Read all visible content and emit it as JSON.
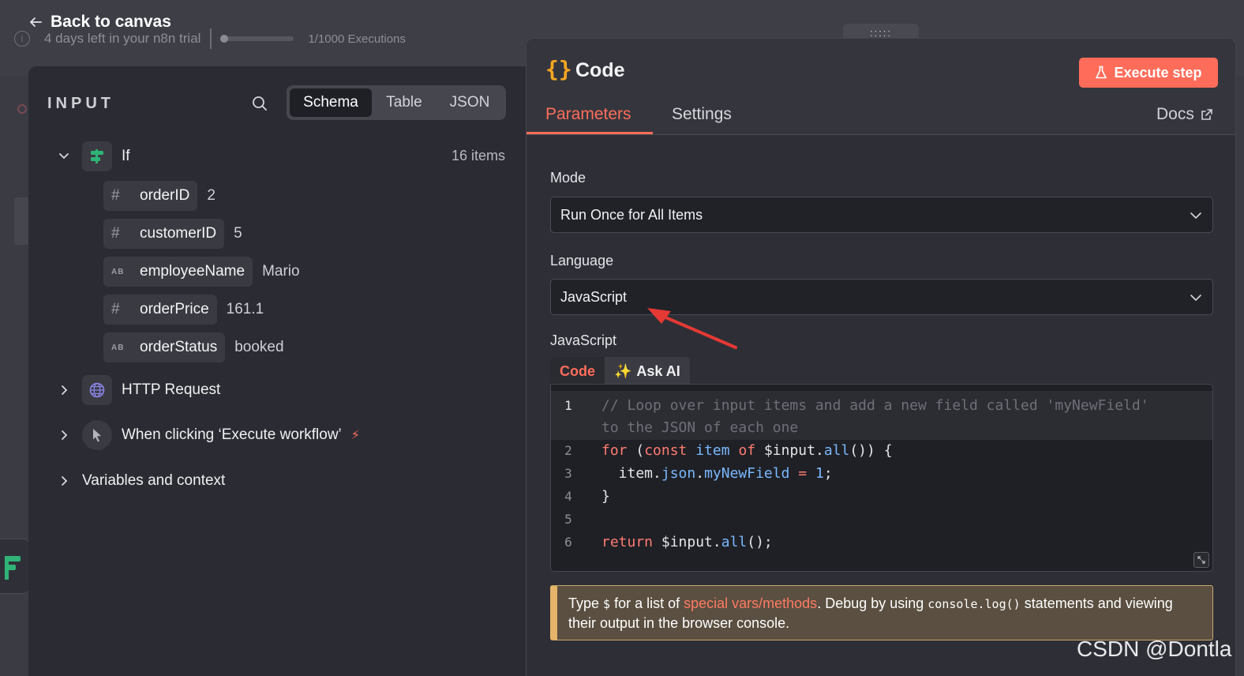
{
  "topbar": {
    "back_label": "Back to canvas",
    "trial_text": "4 days left in your n8n trial",
    "executions_text": "1/1000 Executions",
    "executions_progress": 0.001
  },
  "input_panel": {
    "title": "INPUT",
    "views": [
      "Schema",
      "Table",
      "JSON"
    ],
    "active_view": "Schema",
    "nodes": [
      {
        "label": "If",
        "icon": "if-node-icon",
        "count": "16 items",
        "expanded": true,
        "fields": [
          {
            "type": "#",
            "name": "orderID",
            "value": "2"
          },
          {
            "type": "#",
            "name": "customerID",
            "value": "5"
          },
          {
            "type": "AB",
            "name": "employeeName",
            "value": "Mario"
          },
          {
            "type": "#",
            "name": "orderPrice",
            "value": "161.1"
          },
          {
            "type": "AB",
            "name": "orderStatus",
            "value": "booked"
          }
        ]
      },
      {
        "label": "HTTP Request",
        "icon": "globe-icon",
        "expanded": false
      },
      {
        "label": "When clicking ‘Execute workflow’",
        "icon": "cursor-icon",
        "expanded": false
      }
    ],
    "variables_label": "Variables and context"
  },
  "code_panel": {
    "title": "Code",
    "execute_label": "Execute step",
    "tabs": [
      "Parameters",
      "Settings"
    ],
    "active_tab": "Parameters",
    "docs_label": "Docs",
    "mode": {
      "label": "Mode",
      "value": "Run Once for All Items"
    },
    "language": {
      "label": "Language",
      "value": "JavaScript"
    },
    "editor_label": "JavaScript",
    "editor_tabs": [
      "Code",
      "Ask AI"
    ],
    "ask_ai_icon": "✨",
    "code_lines": [
      "// Loop over input items and add a new field called 'myNewField'",
      "to the JSON of each one",
      "for (const item of $input.all()) {",
      "  item.json.myNewField = 1;",
      "}",
      "",
      "return $input.all();"
    ],
    "line_numbers": [
      "1",
      "2",
      "3",
      "4",
      "5",
      "6"
    ],
    "hint": {
      "pre": "Type ",
      "dollar": "$",
      "mid1": " for a list of ",
      "link": "special vars/methods",
      "mid2": ". Debug by using ",
      "code": "console.log()",
      "post": " statements and viewing their output in the browser console."
    }
  },
  "colors": {
    "accent": "#ff6d5a",
    "if_icon": "#2fb377",
    "braces": "#f6a623"
  },
  "watermark": "CSDN @Dontla"
}
